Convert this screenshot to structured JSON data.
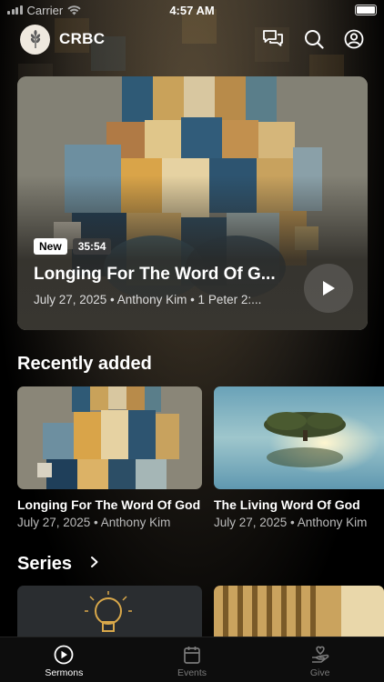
{
  "status_bar": {
    "carrier": "Carrier",
    "time": "4:57 AM"
  },
  "header": {
    "brand": "CRBC"
  },
  "hero": {
    "badge": "New",
    "duration": "35:54",
    "title": "Longing For The Word Of G...",
    "meta": "July 27, 2025 • Anthony Kim • 1 Peter 2:..."
  },
  "recently_added": {
    "title": "Recently added",
    "items": [
      {
        "title": "Longing For The Word Of God",
        "meta": "July 27, 2025 • Anthony Kim"
      },
      {
        "title": "The Living Word Of God",
        "meta": "July 27, 2025 • Anthony Kim"
      }
    ]
  },
  "series": {
    "title": "Series"
  },
  "tabs": [
    {
      "label": "Sermons",
      "icon": "play-circle-icon"
    },
    {
      "label": "Events",
      "icon": "calendar-icon"
    },
    {
      "label": "Give",
      "icon": "giving-hand-icon"
    }
  ]
}
